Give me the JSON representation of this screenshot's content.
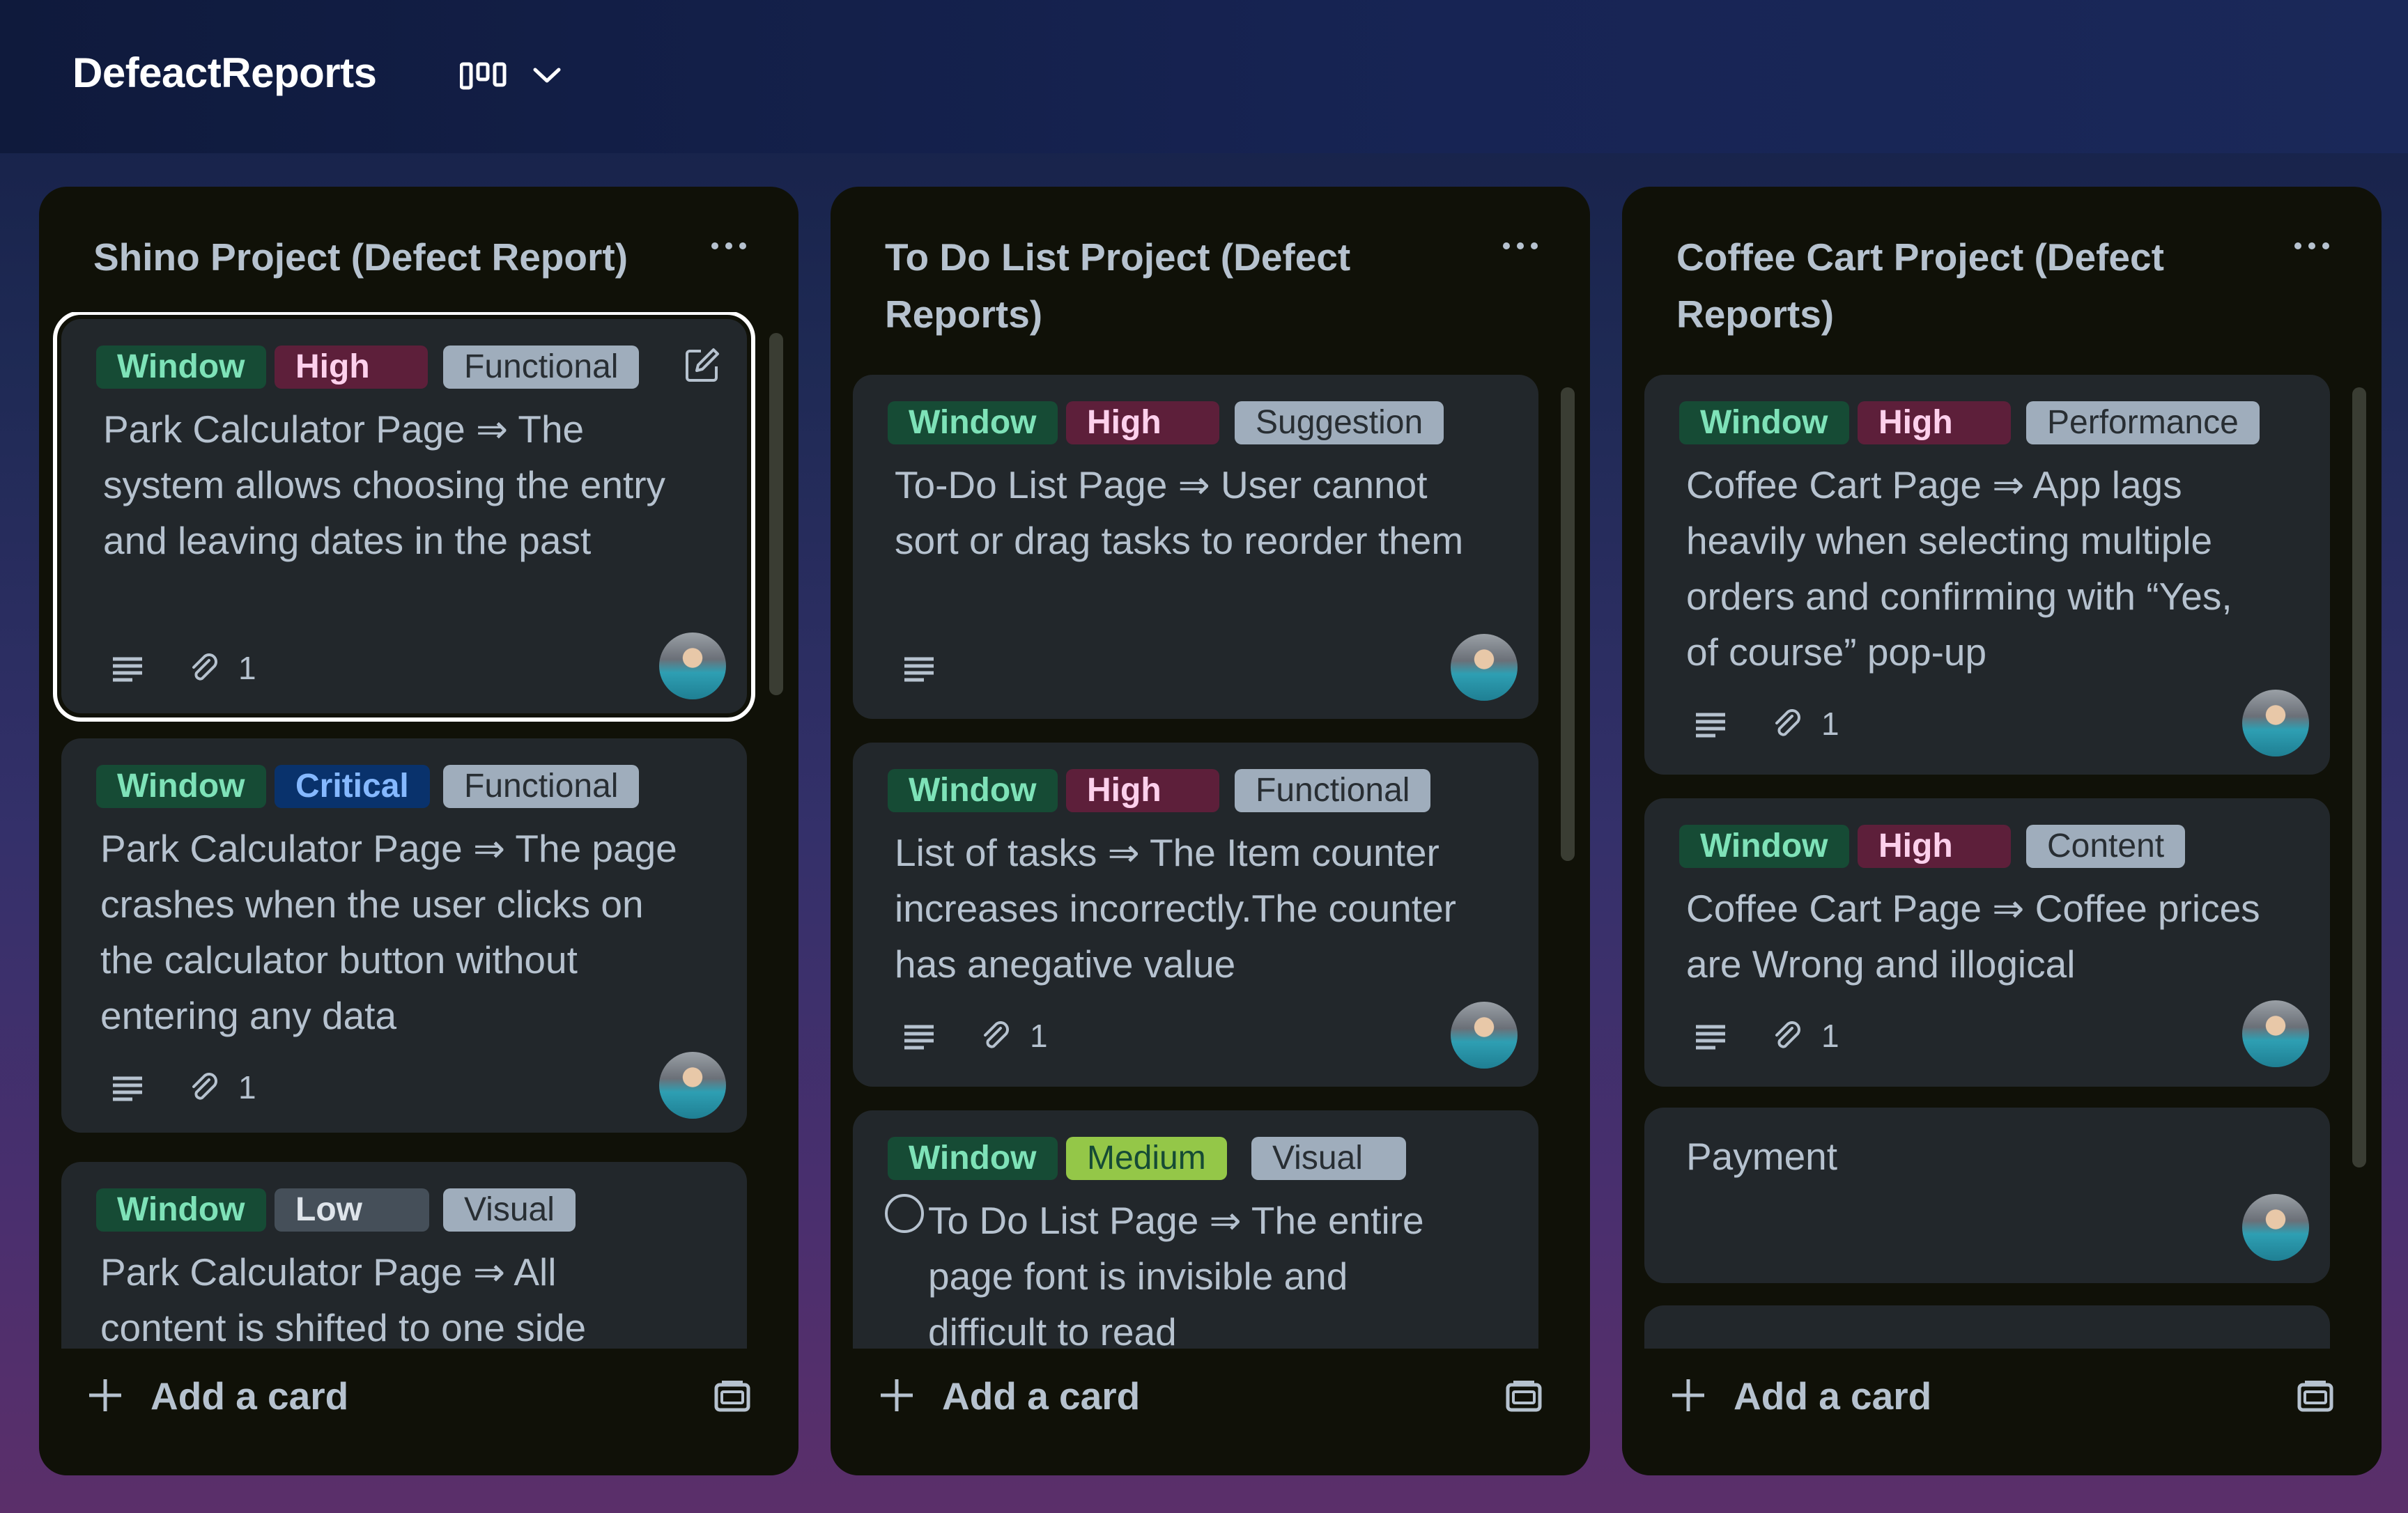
{
  "board": {
    "title": "DefeactReports"
  },
  "lists": [
    {
      "title": "Shino Project (Defect Report)",
      "add_card": "Add a card",
      "cards": [
        {
          "labels": [
            "Window",
            "High",
            "Functional"
          ],
          "text": "Park Calculator Page ⇒ The system allows choosing the entry and leaving dates in the past",
          "attachments": "1"
        },
        {
          "labels": [
            "Window",
            "Critical",
            "Functional"
          ],
          "text": "Park Calculator Page ⇒ The page crashes when the user clicks on the calculator button without entering any data",
          "attachments": "1"
        },
        {
          "labels": [
            "Window",
            "Low",
            "Visual"
          ],
          "text": "Park Calculator Page ⇒ All content is shifted to one side"
        }
      ]
    },
    {
      "title": "To Do List Project (Defect Reports)",
      "add_card": "Add a card",
      "cards": [
        {
          "labels": [
            "Window",
            "High",
            "Suggestion"
          ],
          "text": "To-Do List Page ⇒ User cannot sort or drag tasks to reorder them"
        },
        {
          "labels": [
            "Window",
            "High",
            "Functional"
          ],
          "text": "List of tasks ⇒ The Item counter increases incorrectly.The counter has anegative value",
          "attachments": "1"
        },
        {
          "labels": [
            "Window",
            "Medium",
            "Visual"
          ],
          "text": "To Do List Page ⇒ The entire page font is invisible and difficult to read"
        }
      ]
    },
    {
      "title": "Coffee Cart Project (Defect Reports)",
      "add_card": "Add a card",
      "cards": [
        {
          "labels": [
            "Window",
            "High",
            "Performance"
          ],
          "text": "Coffee Cart Page ⇒ App lags heavily when selecting multiple orders and confirming with “Yes, of course” pop-up",
          "attachments": "1"
        },
        {
          "labels": [
            "Window",
            "High",
            "Content"
          ],
          "text": "Coffee Cart Page ⇒ Coffee prices are Wrong and illogical",
          "attachments": "1"
        },
        {
          "text": "Payment"
        }
      ]
    }
  ],
  "colors": {
    "label_window": "#164b35",
    "label_high": "#5d1f3a",
    "label_critical": "#09326c",
    "label_low": "#454f59",
    "label_medium": "#94c748",
    "label_gray": "#9fadbc",
    "list_bg": "#101108",
    "card_bg": "#22272b"
  },
  "icons": [
    "board-view-icon",
    "chevron-down-icon",
    "more-icon",
    "edit-icon",
    "description-icon",
    "attachment-icon",
    "plus-icon",
    "template-icon",
    "avatar"
  ]
}
